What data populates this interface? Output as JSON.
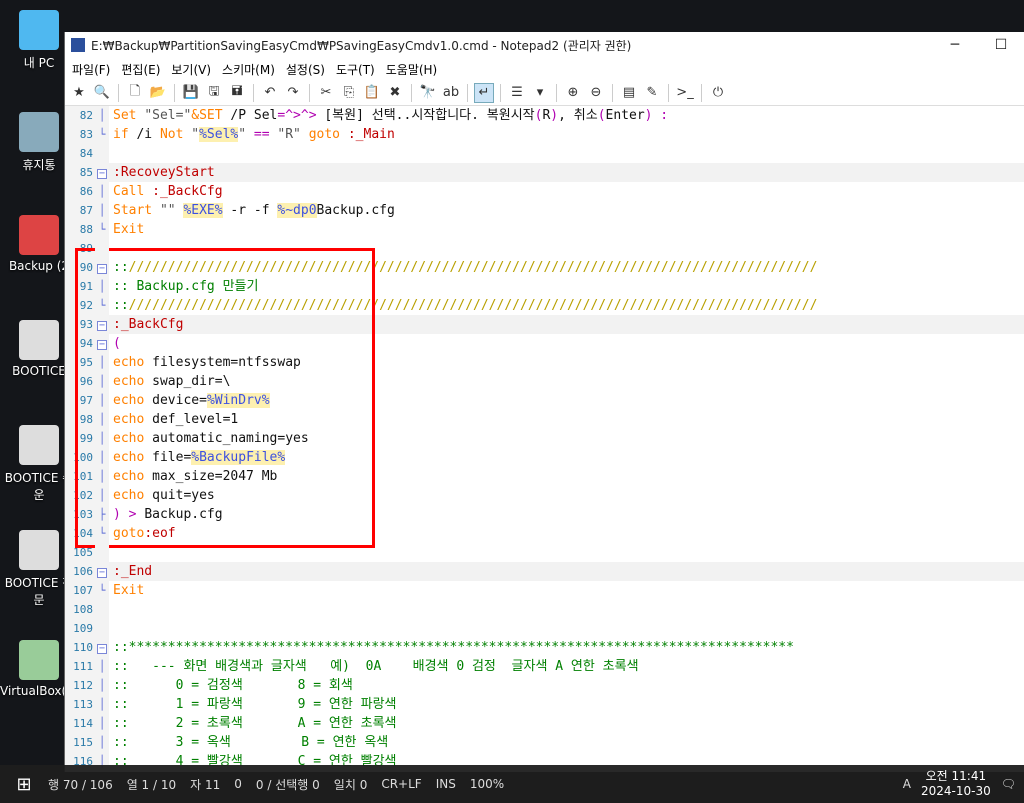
{
  "desktop": {
    "icons": [
      {
        "label": "내 PC",
        "color": "#4fb8f0"
      },
      {
        "label": "휴지통",
        "color": "#8ab"
      },
      {
        "label": "Backup (2",
        "color": "#d44"
      },
      {
        "label": "BOOTICE",
        "color": "#ddd"
      },
      {
        "label": "BOOTICE 쉬운",
        "color": "#ddd"
      },
      {
        "label": "BOOTICE 전문",
        "color": "#ddd"
      },
      {
        "label": "VirtualBox(Z)",
        "color": "#9c9"
      }
    ]
  },
  "window": {
    "title": "E:₩Backup₩PartitionSavingEasyCmd₩PSavingEasyCmdv1.0.cmd - Notepad2 (관리자 권한)",
    "minimize": "─",
    "maximize": "☐"
  },
  "menu": [
    "파일(F)",
    "편집(E)",
    "보기(V)",
    "스키마(M)",
    "설정(S)",
    "도구(T)",
    "도움말(H)"
  ],
  "toolbar": [
    {
      "icon": "favorites-icon",
      "g": "★"
    },
    {
      "icon": "find-file-icon",
      "g": "🔍"
    },
    "sep",
    {
      "icon": "new-icon",
      "g": "🗋"
    },
    {
      "icon": "open-icon",
      "g": "📂"
    },
    "sep",
    {
      "icon": "save-icon",
      "g": "💾"
    },
    {
      "icon": "save-as-icon",
      "g": "🖫"
    },
    {
      "icon": "save-copy-icon",
      "g": "🖬"
    },
    "sep",
    {
      "icon": "undo-icon",
      "g": "↶"
    },
    {
      "icon": "redo-icon",
      "g": "↷"
    },
    "sep",
    {
      "icon": "cut-icon",
      "g": "✂"
    },
    {
      "icon": "copy-icon",
      "g": "⎘"
    },
    {
      "icon": "paste-icon",
      "g": "📋"
    },
    {
      "icon": "delete-icon",
      "g": "✖"
    },
    "sep",
    {
      "icon": "find-icon",
      "g": "🔭"
    },
    {
      "icon": "replace-icon",
      "g": "ab"
    },
    "sep",
    {
      "icon": "word-wrap-icon",
      "g": "↵",
      "active": true
    },
    "sep",
    {
      "icon": "scheme-icon",
      "g": "☰"
    },
    {
      "icon": "dropdown-icon",
      "g": "▾"
    },
    "sep",
    {
      "icon": "zoom-in-icon",
      "g": "⊕"
    },
    {
      "icon": "zoom-out-icon",
      "g": "⊖"
    },
    "sep",
    {
      "icon": "scheme-config-icon",
      "g": "▤"
    },
    {
      "icon": "customize-icon",
      "g": "✎"
    },
    "sep",
    {
      "icon": "console-icon",
      "g": ">_"
    },
    "sep",
    {
      "icon": "exit-icon",
      "g": "⏻"
    }
  ],
  "lines": [
    {
      "n": "82",
      "f": "│",
      "t": [
        [
          "Set ",
          "kw"
        ],
        [
          "\"Sel=\"",
          "str"
        ],
        [
          "&SET",
          "kw"
        ],
        [
          " /P Sel",
          "pl"
        ],
        [
          "=^>^>",
          "op"
        ],
        [
          " [복원] 선택..시작합니다. 복원시작",
          "pl"
        ],
        [
          "(",
          "op"
        ],
        [
          "R",
          "pl"
        ],
        [
          ")",
          "op"
        ],
        [
          ", 취소",
          "pl"
        ],
        [
          "(",
          "op"
        ],
        [
          "Enter",
          "pl"
        ],
        [
          ")",
          "op"
        ],
        [
          " :",
          "op"
        ]
      ]
    },
    {
      "n": "83",
      "f": "└",
      "t": [
        [
          "if",
          "kw"
        ],
        [
          " /i ",
          "pl"
        ],
        [
          "Not",
          "kw"
        ],
        [
          " \"",
          "str"
        ],
        [
          "%Sel%",
          "var"
        ],
        [
          "\" ",
          "str"
        ],
        [
          "==",
          "op"
        ],
        [
          " \"R\" ",
          "str"
        ],
        [
          "goto",
          "kw"
        ],
        [
          " :_Main",
          "lbl"
        ]
      ]
    },
    {
      "n": "84",
      "f": "",
      "t": []
    },
    {
      "n": "85",
      "f": "box",
      "hl": true,
      "t": [
        [
          ":RecoveyStart",
          "lbl"
        ]
      ]
    },
    {
      "n": "86",
      "f": "│",
      "t": [
        [
          "Call",
          "kw"
        ],
        [
          " :_BackCfg",
          "lbl"
        ]
      ]
    },
    {
      "n": "87",
      "f": "│",
      "t": [
        [
          "Start",
          "kw"
        ],
        [
          " \"\" ",
          "str"
        ],
        [
          "%EXE%",
          "var"
        ],
        [
          " -r -f ",
          "pl"
        ],
        [
          "%~dp0",
          "var"
        ],
        [
          "Backup.cfg",
          "pl"
        ]
      ]
    },
    {
      "n": "88",
      "f": "└",
      "t": [
        [
          "Exit",
          "kw"
        ]
      ]
    },
    {
      "n": "89",
      "f": "",
      "t": []
    },
    {
      "n": "90",
      "f": "box",
      "t": [
        [
          "::",
          "cmt"
        ],
        [
          "////////////////////////////////////////////////////////////////////////////////////////",
          "sl"
        ]
      ]
    },
    {
      "n": "91",
      "f": "│",
      "t": [
        [
          ":: Backup.cfg 만들기",
          "cmt"
        ]
      ]
    },
    {
      "n": "92",
      "f": "└",
      "t": [
        [
          "::",
          "cmt"
        ],
        [
          "////////////////////////////////////////////////////////////////////////////////////////",
          "sl"
        ]
      ]
    },
    {
      "n": "93",
      "f": "box",
      "hl": true,
      "t": [
        [
          ":_BackCfg",
          "lbl"
        ]
      ]
    },
    {
      "n": "94",
      "f": "box",
      "t": [
        [
          "(",
          "op"
        ]
      ]
    },
    {
      "n": "95",
      "f": "│",
      "t": [
        [
          "echo",
          "kw"
        ],
        [
          " filesystem=ntfsswap",
          "pl"
        ]
      ]
    },
    {
      "n": "96",
      "f": "│",
      "t": [
        [
          "echo",
          "kw"
        ],
        [
          " swap_dir=\\",
          "pl"
        ]
      ]
    },
    {
      "n": "97",
      "f": "│",
      "t": [
        [
          "echo",
          "kw"
        ],
        [
          " device=",
          "pl"
        ],
        [
          "%WinDrv%",
          "var"
        ]
      ]
    },
    {
      "n": "98",
      "f": "│",
      "t": [
        [
          "echo",
          "kw"
        ],
        [
          " def_level=1",
          "pl"
        ]
      ]
    },
    {
      "n": "99",
      "f": "│",
      "t": [
        [
          "echo",
          "kw"
        ],
        [
          " automatic_naming=yes",
          "pl"
        ]
      ]
    },
    {
      "n": "100",
      "f": "│",
      "t": [
        [
          "echo",
          "kw"
        ],
        [
          " file=",
          "pl"
        ],
        [
          "%BackupFile%",
          "var"
        ]
      ]
    },
    {
      "n": "101",
      "f": "│",
      "t": [
        [
          "echo",
          "kw"
        ],
        [
          " max_size=2047 Mb",
          "pl"
        ]
      ]
    },
    {
      "n": "102",
      "f": "│",
      "t": [
        [
          "echo",
          "kw"
        ],
        [
          " quit=yes",
          "pl"
        ]
      ]
    },
    {
      "n": "103",
      "f": "├",
      "t": [
        [
          ")",
          "op"
        ],
        [
          " > ",
          "op"
        ],
        [
          "Backup.cfg",
          "pl"
        ]
      ]
    },
    {
      "n": "104",
      "f": "└",
      "t": [
        [
          "goto",
          "kw"
        ],
        [
          ":eof",
          "lbl"
        ]
      ]
    },
    {
      "n": "105",
      "f": "",
      "t": []
    },
    {
      "n": "106",
      "f": "box",
      "hl": true,
      "t": [
        [
          ":_End",
          "lbl"
        ]
      ]
    },
    {
      "n": "107",
      "f": "└",
      "t": [
        [
          "Exit",
          "kw"
        ]
      ]
    },
    {
      "n": "108",
      "f": "",
      "t": []
    },
    {
      "n": "109",
      "f": "",
      "t": []
    },
    {
      "n": "110",
      "f": "box",
      "t": [
        [
          "::*************************************************************************************",
          "cmt"
        ]
      ]
    },
    {
      "n": "111",
      "f": "│",
      "t": [
        [
          "::   --- 화면 배경색과 글자색   예)  0A    배경색 0 검정  글자색 A 연한 초록색",
          "cmt"
        ]
      ]
    },
    {
      "n": "112",
      "f": "│",
      "t": [
        [
          "::      0 = 검정색       8 = 회색",
          "cmt"
        ]
      ]
    },
    {
      "n": "113",
      "f": "│",
      "t": [
        [
          "::      1 = 파랑색       9 = 연한 파랑색",
          "cmt"
        ]
      ]
    },
    {
      "n": "114",
      "f": "│",
      "t": [
        [
          "::      2 = 초록색       A = 연한 초록색",
          "cmt"
        ]
      ]
    },
    {
      "n": "115",
      "f": "│",
      "t": [
        [
          "::      3 = 옥색         B = 연한 옥색",
          "cmt"
        ]
      ]
    },
    {
      "n": "116",
      "f": "│",
      "t": [
        [
          "::      4 = 빨강색       C = 연한 빨강색",
          "cmt"
        ]
      ]
    }
  ],
  "statusbar": [
    "행 70 / 106",
    "열 1 / 10",
    "자 11",
    "0",
    "0 / 선택행 0",
    "일치 0",
    "CR+LF",
    "INS",
    "100%"
  ],
  "taskbar": {
    "start": "⊞",
    "clock_time": "오전 11:41",
    "clock_date": "2024-10-30",
    "ime": "A",
    "notif": "🗨"
  }
}
